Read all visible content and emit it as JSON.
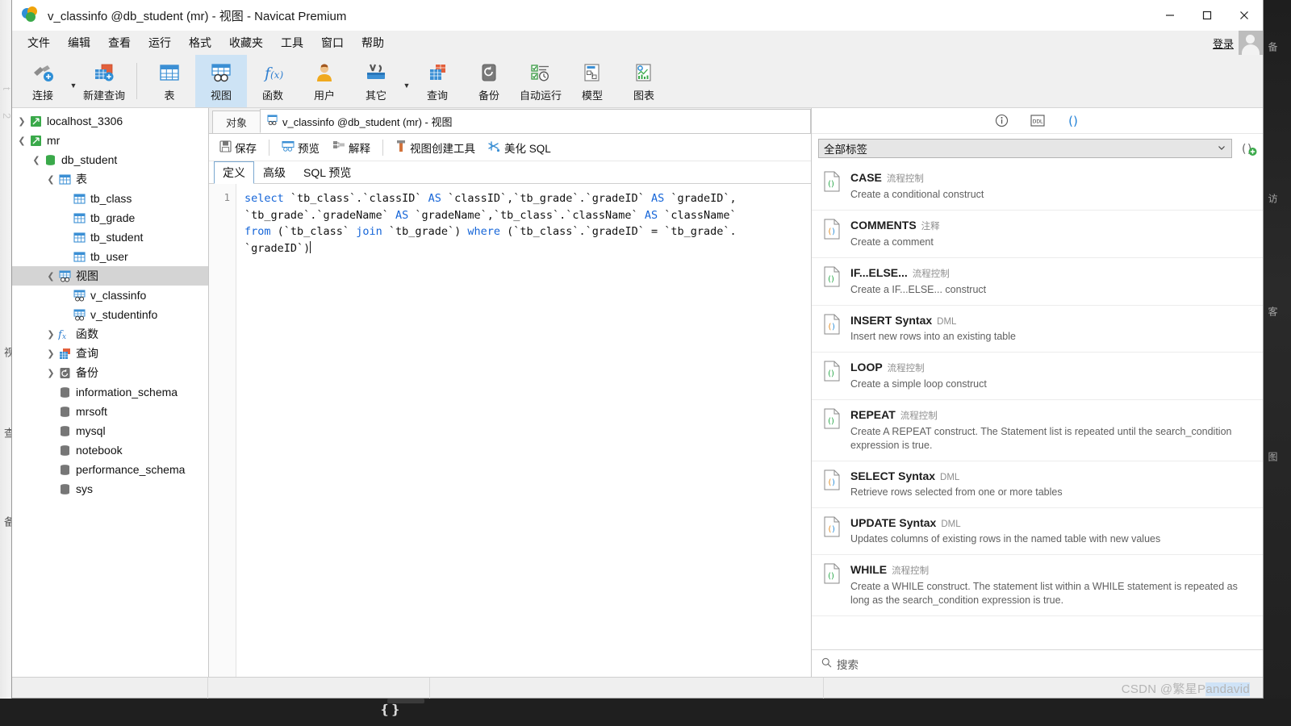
{
  "window": {
    "title": "v_classinfo @db_student (mr) - 视图 - Navicat Premium",
    "app_icon": "navicat-logo-icon",
    "minimize_label": "最小化",
    "maximize_label": "最大化",
    "close_label": "关闭"
  },
  "menubar": {
    "items": [
      {
        "label": "文件",
        "name": "menu-file"
      },
      {
        "label": "编辑",
        "name": "menu-edit"
      },
      {
        "label": "查看",
        "name": "menu-view"
      },
      {
        "label": "运行",
        "name": "menu-run"
      },
      {
        "label": "格式",
        "name": "menu-format"
      },
      {
        "label": "收藏夹",
        "name": "menu-favorites"
      },
      {
        "label": "工具",
        "name": "menu-tools"
      },
      {
        "label": "窗口",
        "name": "menu-window"
      },
      {
        "label": "帮助",
        "name": "menu-help"
      }
    ],
    "login_label": "登录",
    "avatar": "user-avatar-icon"
  },
  "toolbar": {
    "buttons": [
      {
        "label": "连接",
        "icon": "connection-icon",
        "has_caret": true,
        "active": false
      },
      {
        "label": "新建查询",
        "icon": "new-query-icon",
        "has_caret": false,
        "active": false
      },
      {
        "label": "表",
        "icon": "table-icon",
        "has_caret": false,
        "active": false
      },
      {
        "label": "视图",
        "icon": "view-icon",
        "has_caret": false,
        "active": true
      },
      {
        "label": "函数",
        "icon": "function-icon",
        "has_caret": false,
        "active": false
      },
      {
        "label": "用户",
        "icon": "user-icon",
        "has_caret": false,
        "active": false
      },
      {
        "label": "其它",
        "icon": "other-tools-icon",
        "has_caret": true,
        "active": false
      },
      {
        "label": "查询",
        "icon": "query-icon",
        "has_caret": false,
        "active": false
      },
      {
        "label": "备份",
        "icon": "backup-icon",
        "has_caret": false,
        "active": false
      },
      {
        "label": "自动运行",
        "icon": "automation-icon",
        "has_caret": false,
        "active": false
      },
      {
        "label": "模型",
        "icon": "model-icon",
        "has_caret": false,
        "active": false
      },
      {
        "label": "图表",
        "icon": "chart-icon",
        "has_caret": false,
        "active": false
      }
    ]
  },
  "sidebar": {
    "items": [
      {
        "label": "localhost_3306",
        "indent": 0,
        "twisty": "collapsed",
        "icon": "connection-node-icon",
        "selected": false
      },
      {
        "label": "mr",
        "indent": 0,
        "twisty": "expanded",
        "icon": "connection-node-icon",
        "selected": false
      },
      {
        "label": "db_student",
        "indent": 1,
        "twisty": "expanded",
        "icon": "database-icon",
        "selected": false
      },
      {
        "label": "表",
        "indent": 2,
        "twisty": "expanded",
        "icon": "table-folder-icon",
        "selected": false
      },
      {
        "label": "tb_class",
        "indent": 3,
        "twisty": "none",
        "icon": "table-icon",
        "selected": false
      },
      {
        "label": "tb_grade",
        "indent": 3,
        "twisty": "none",
        "icon": "table-icon",
        "selected": false
      },
      {
        "label": "tb_student",
        "indent": 3,
        "twisty": "none",
        "icon": "table-icon",
        "selected": false
      },
      {
        "label": "tb_user",
        "indent": 3,
        "twisty": "none",
        "icon": "table-icon",
        "selected": false
      },
      {
        "label": "视图",
        "indent": 2,
        "twisty": "expanded",
        "icon": "view-folder-icon",
        "selected": true
      },
      {
        "label": "v_classinfo",
        "indent": 3,
        "twisty": "none",
        "icon": "view-icon",
        "selected": false
      },
      {
        "label": "v_studentinfo",
        "indent": 3,
        "twisty": "none",
        "icon": "view-icon",
        "selected": false
      },
      {
        "label": "函数",
        "indent": 2,
        "twisty": "collapsed",
        "icon": "function-folder-icon",
        "selected": false
      },
      {
        "label": "查询",
        "indent": 2,
        "twisty": "collapsed",
        "icon": "query-folder-icon",
        "selected": false
      },
      {
        "label": "备份",
        "indent": 2,
        "twisty": "collapsed",
        "icon": "backup-folder-icon",
        "selected": false
      },
      {
        "label": "information_schema",
        "indent": 1,
        "twisty": "none",
        "icon": "database-icon",
        "selected": false
      },
      {
        "label": "mrsoft",
        "indent": 1,
        "twisty": "none",
        "icon": "database-icon",
        "selected": false
      },
      {
        "label": "mysql",
        "indent": 1,
        "twisty": "none",
        "icon": "database-icon",
        "selected": false
      },
      {
        "label": "notebook",
        "indent": 1,
        "twisty": "none",
        "icon": "database-icon",
        "selected": false
      },
      {
        "label": "performance_schema",
        "indent": 1,
        "twisty": "none",
        "icon": "database-icon",
        "selected": false
      },
      {
        "label": "sys",
        "indent": 1,
        "twisty": "none",
        "icon": "database-icon",
        "selected": false
      }
    ]
  },
  "editor": {
    "object_tab": "对象",
    "doc_tab": "v_classinfo @db_student (mr) - 视图",
    "doc_tab_icon": "view-doc-icon",
    "actions": [
      {
        "label": "保存",
        "icon": "save-icon"
      },
      {
        "label": "预览",
        "icon": "preview-icon"
      },
      {
        "label": "解释",
        "icon": "explain-icon"
      },
      {
        "label": "视图创建工具",
        "icon": "view-builder-icon"
      },
      {
        "label": "美化 SQL",
        "icon": "beautify-sql-icon"
      }
    ],
    "subtabs": [
      {
        "label": "定义",
        "active": true
      },
      {
        "label": "高级",
        "active": false
      },
      {
        "label": "SQL 预览",
        "active": false
      }
    ],
    "line_number": "1",
    "sql_tokens": [
      {
        "t": "select",
        "kw": true
      },
      {
        "t": " `tb_class`.`classID` ",
        "kw": false
      },
      {
        "t": "AS",
        "kw": true
      },
      {
        "t": " `classID`,`tb_grade`.`gradeID` ",
        "kw": false
      },
      {
        "t": "AS",
        "kw": true
      },
      {
        "t": " `gradeID`,\n`tb_grade`.`gradeName` ",
        "kw": false
      },
      {
        "t": "AS",
        "kw": true
      },
      {
        "t": " `gradeName`,`tb_class`.`className` ",
        "kw": false
      },
      {
        "t": "AS",
        "kw": true
      },
      {
        "t": " `className`\n",
        "kw": false
      },
      {
        "t": "from",
        "kw": true
      },
      {
        "t": " (`tb_class` ",
        "kw": false
      },
      {
        "t": "join",
        "kw": true
      },
      {
        "t": " `tb_grade`) ",
        "kw": false
      },
      {
        "t": "where",
        "kw": true
      },
      {
        "t": " (`tb_class`.`gradeID` = `tb_grade`.\n`gradeID`)",
        "kw": false
      }
    ]
  },
  "right_panel": {
    "icons": [
      {
        "name": "info-icon",
        "label": "信息"
      },
      {
        "name": "ddl-icon",
        "label": "DDL"
      },
      {
        "name": "snippets-icon",
        "label": "代码段"
      }
    ],
    "filter_value": "全部标签",
    "filter_caret": "chevron-down-icon",
    "add_button": "add-snippet-icon",
    "search_placeholder": "搜索",
    "search_icon": "search-icon",
    "snippets": [
      {
        "title": "CASE",
        "tag": "流程控制",
        "desc": "Create a conditional construct",
        "icon_color": "#2aa84a"
      },
      {
        "title": "COMMENTS",
        "tag": "注释",
        "desc": "Create a comment",
        "icon_color": "#e08a1e"
      },
      {
        "title": "IF...ELSE...",
        "tag": "流程控制",
        "desc": "Create a IF...ELSE... construct",
        "icon_color": "#2aa84a"
      },
      {
        "title": "INSERT Syntax",
        "tag": "DML",
        "desc": "Insert new rows into an existing table",
        "icon_color": "#e08a1e"
      },
      {
        "title": "LOOP",
        "tag": "流程控制",
        "desc": "Create a simple loop construct",
        "icon_color": "#2aa84a"
      },
      {
        "title": "REPEAT",
        "tag": "流程控制",
        "desc": "Create A REPEAT construct. The Statement list is repeated until the search_condition expression is true.",
        "icon_color": "#2aa84a"
      },
      {
        "title": "SELECT Syntax",
        "tag": "DML",
        "desc": "Retrieve rows selected from one or more tables",
        "icon_color": "#e08a1e"
      },
      {
        "title": "UPDATE Syntax",
        "tag": "DML",
        "desc": "Updates columns of existing rows in the named table with new values",
        "icon_color": "#e08a1e"
      },
      {
        "title": "WHILE",
        "tag": "流程控制",
        "desc": "Create a WHILE construct. The statement list within a WHILE statement is repeated as long as the search_condition expression is true.",
        "icon_color": "#2aa84a"
      }
    ]
  },
  "statusbar": {
    "watermark_prefix": "CSDN @繁星P",
    "watermark_selected": "andavid"
  },
  "colors": {
    "accent": "#cde3f5",
    "keyword": "#1565d8",
    "selection": "#d4d4d4",
    "snippet_green": "#2aa84a",
    "snippet_orange": "#e08a1e"
  }
}
